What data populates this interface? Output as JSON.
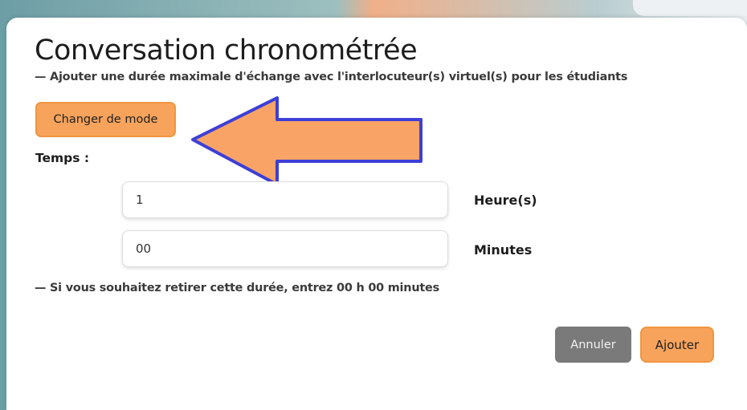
{
  "dialog": {
    "title": "Conversation chronométrée",
    "subtitle": "— Ajouter une durée maximale d'échange avec l'interlocuteur(s) virtuel(s) pour les étudiants",
    "mode_button_label": "Changer de mode",
    "time_label": "Temps :",
    "hours": {
      "value": "1",
      "unit_label": "Heure(s)"
    },
    "minutes": {
      "value": "00",
      "unit_label": "Minutes"
    },
    "hint": "— Si vous souhaitez retirer cette durée, entrez 00 h 00 minutes",
    "cancel_label": "Annuler",
    "add_label": "Ajouter"
  },
  "annotation": {
    "arrow_icon": "left-arrow-icon",
    "fill_color": "#f9a466",
    "stroke_color": "#3d3fd6"
  },
  "colors": {
    "accent": "#f7a35c",
    "cancel": "#7a7a7a"
  }
}
